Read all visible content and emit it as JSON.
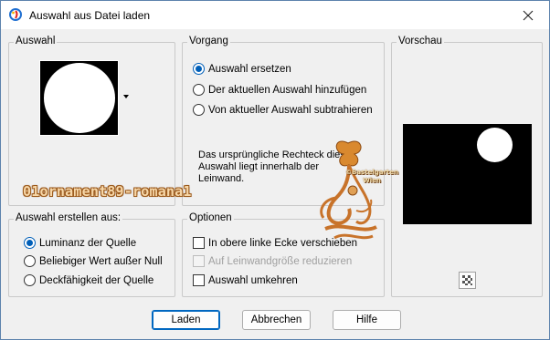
{
  "window": {
    "title": "Auswahl aus Datei laden",
    "close_icon": "close-icon",
    "app_icon": "paintshop-icon"
  },
  "auswahl": {
    "legend": "Auswahl",
    "dropdown_icon": "chevron-down-icon"
  },
  "vorgang": {
    "legend": "Vorgang",
    "options": [
      {
        "label": "Auswahl ersetzen",
        "selected": true
      },
      {
        "label": "Der aktuellen Auswahl hinzufügen",
        "selected": false
      },
      {
        "label": "Von aktueller Auswahl subtrahieren",
        "selected": false
      }
    ],
    "info_line1": "Das ursprüngliche Rechteck dieser",
    "info_line2": "Auswahl liegt innerhalb der",
    "info_line3": "Leinwand."
  },
  "vorschau": {
    "legend": "Vorschau",
    "zoom_icon": "checkerboard-icon"
  },
  "erstellen": {
    "legend": "Auswahl erstellen aus:",
    "options": [
      {
        "label": "Luminanz der Quelle",
        "selected": true
      },
      {
        "label": "Beliebiger Wert außer Null",
        "selected": false
      },
      {
        "label": "Deckfähigkeit der Quelle",
        "selected": false
      }
    ]
  },
  "optionen": {
    "legend": "Optionen",
    "items": [
      {
        "label": "In obere linke Ecke verschieben",
        "checked": false,
        "enabled": true
      },
      {
        "label": "Auf Leinwandgröße reduzieren",
        "checked": false,
        "enabled": false
      },
      {
        "label": "Auswahl umkehren",
        "checked": false,
        "enabled": true
      }
    ]
  },
  "buttons": {
    "laden": "Laden",
    "abbrechen": "Abbrechen",
    "hilfe": "Hilfe"
  },
  "watermark": {
    "text": "01ornament89-romana1",
    "stamp_line1": "©Bastelgarten",
    "stamp_line2": "Wien"
  },
  "colors": {
    "accent": "#005fb8",
    "ornament": "#c8732a"
  }
}
